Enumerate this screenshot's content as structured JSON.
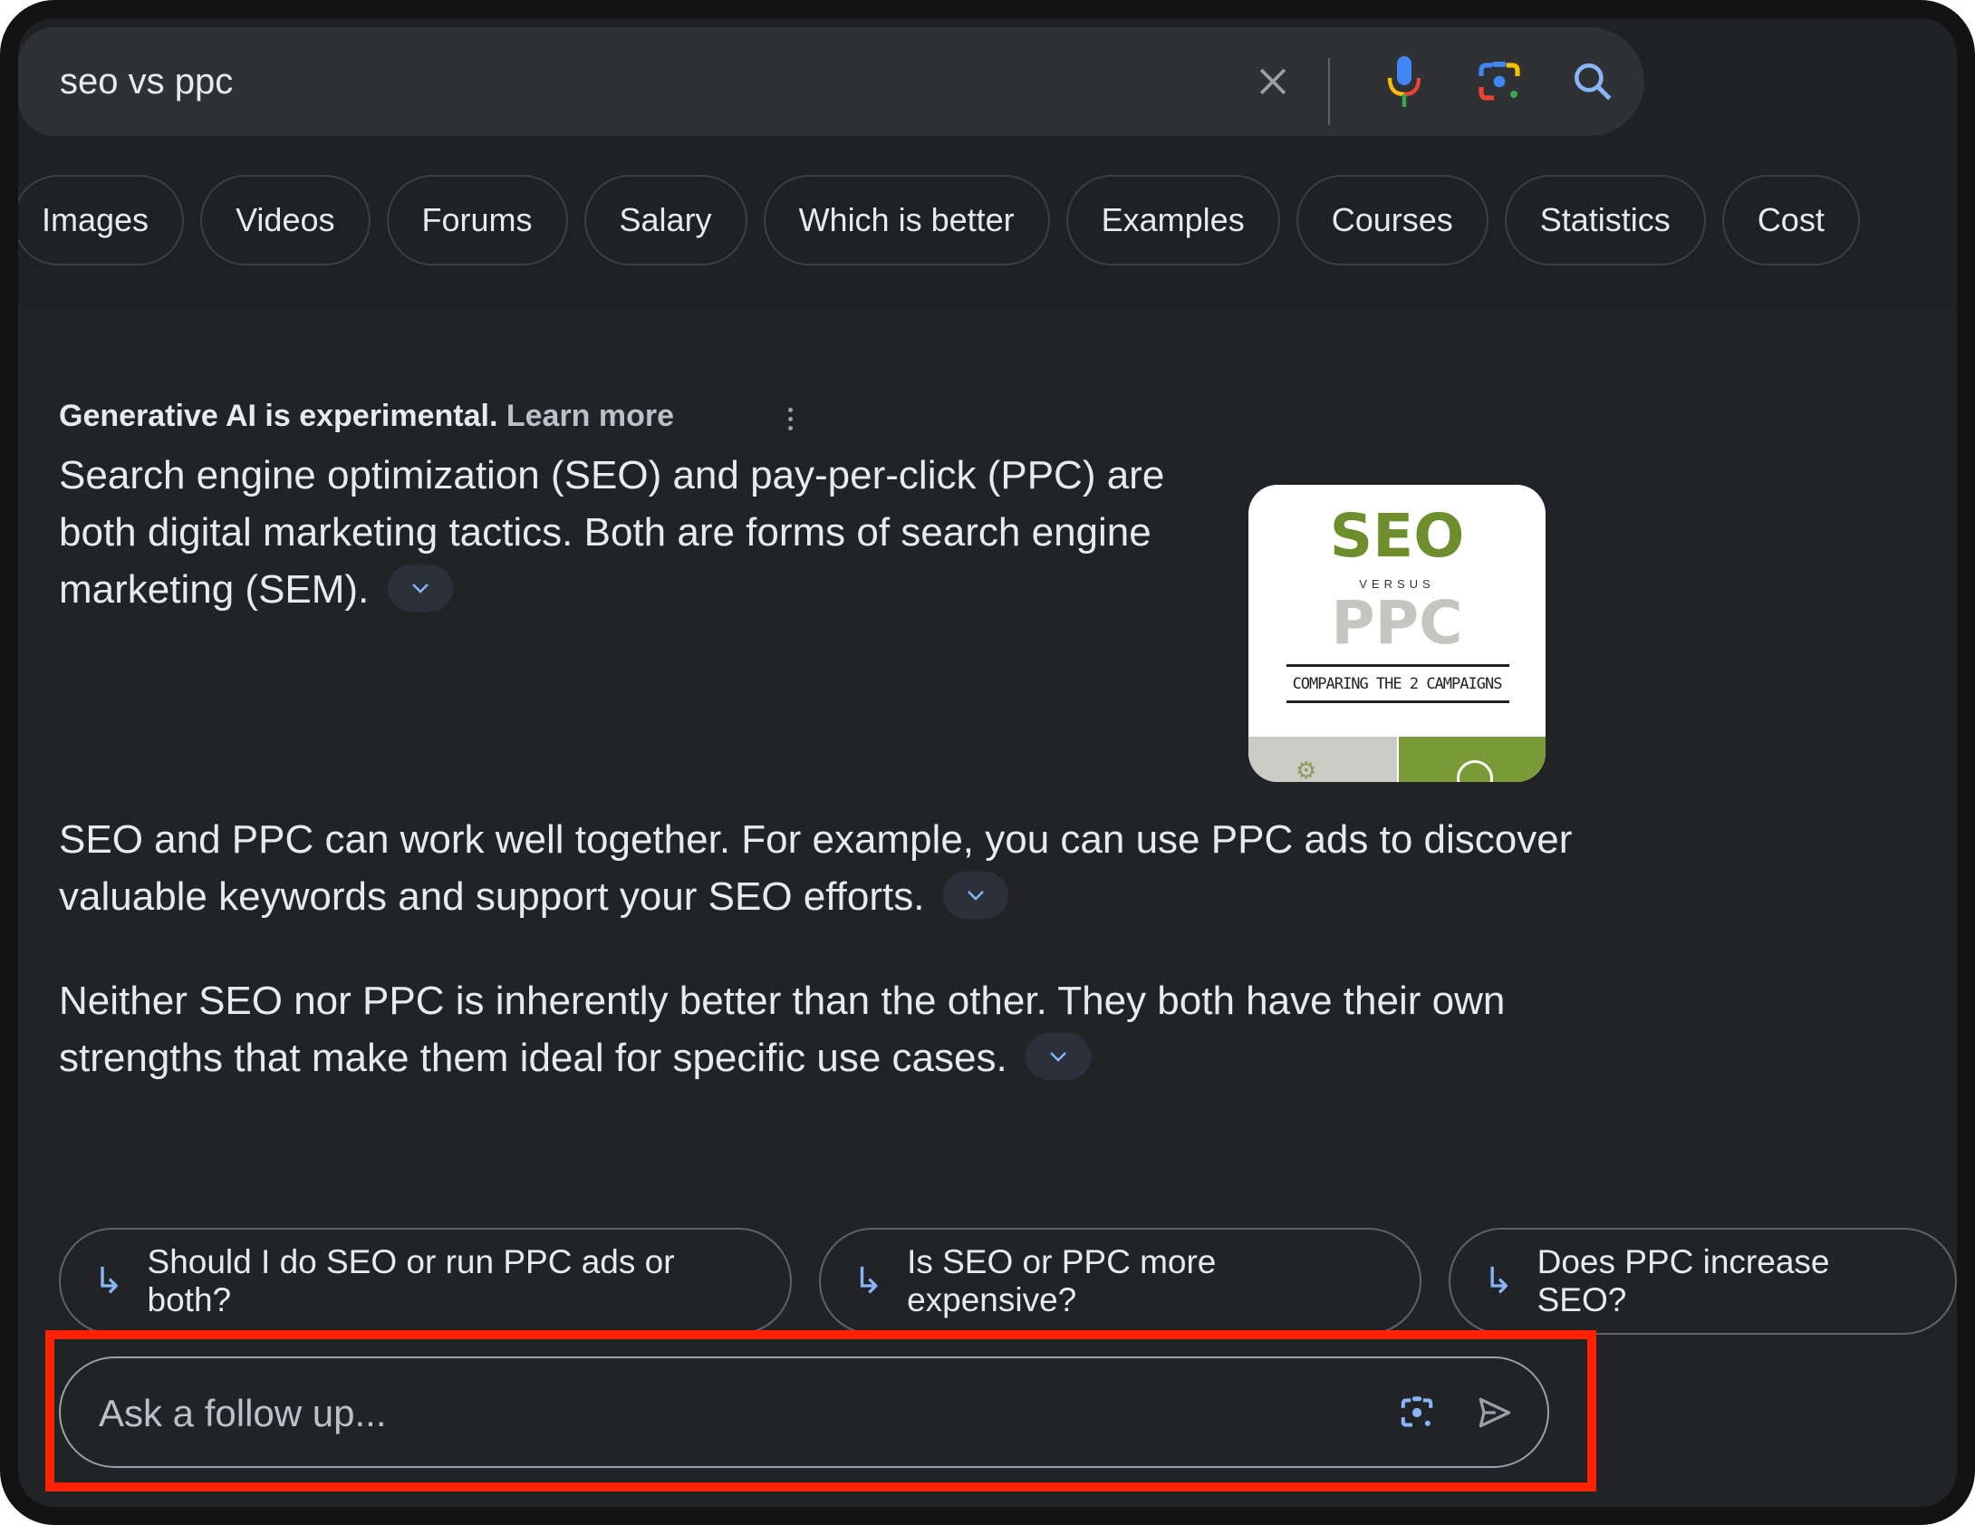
{
  "search": {
    "query": "seo vs ppc",
    "icons": [
      "close-icon",
      "microphone-icon",
      "google-lens-icon",
      "search-icon"
    ]
  },
  "chips": [
    {
      "label": "Images"
    },
    {
      "label": "Videos"
    },
    {
      "label": "Forums"
    },
    {
      "label": "Salary"
    },
    {
      "label": "Which is better"
    },
    {
      "label": "Examples"
    },
    {
      "label": "Courses"
    },
    {
      "label": "Statistics"
    },
    {
      "label": "Cost"
    }
  ],
  "ai_overview": {
    "disclaimer": "Generative AI is experimental.",
    "learn_more": "Learn more",
    "paragraphs": [
      {
        "text": "Search engine optimization (SEO) and pay-per-click (PPC) are both digital marketing tactics. Both are forms of search engine marketing (SEM)."
      },
      {
        "text": "SEO and PPC can work well together. For example, you can use PPC ads to discover valuable keywords and support your SEO efforts."
      },
      {
        "text": "Neither SEO nor PPC is inherently better than the other. They both have their own strengths that make them ideal for specific use cases."
      }
    ],
    "image": {
      "title_top": "SEO",
      "versus": "VERSUS",
      "title_bottom": "PPC",
      "caption": "COMPARING THE 2 CAMPAIGNS",
      "accent_color": "#6e8e2e"
    }
  },
  "followups": [
    {
      "label": "Should I do SEO or run PPC ads or both?"
    },
    {
      "label": "Is SEO or PPC more expensive?"
    },
    {
      "label": "Does PPC increase SEO?"
    }
  ],
  "ask": {
    "placeholder": "Ask a follow up...",
    "value": ""
  },
  "colors": {
    "background": "#202124",
    "highlight": "#ff2200",
    "link_blue": "#8ab4f8"
  }
}
